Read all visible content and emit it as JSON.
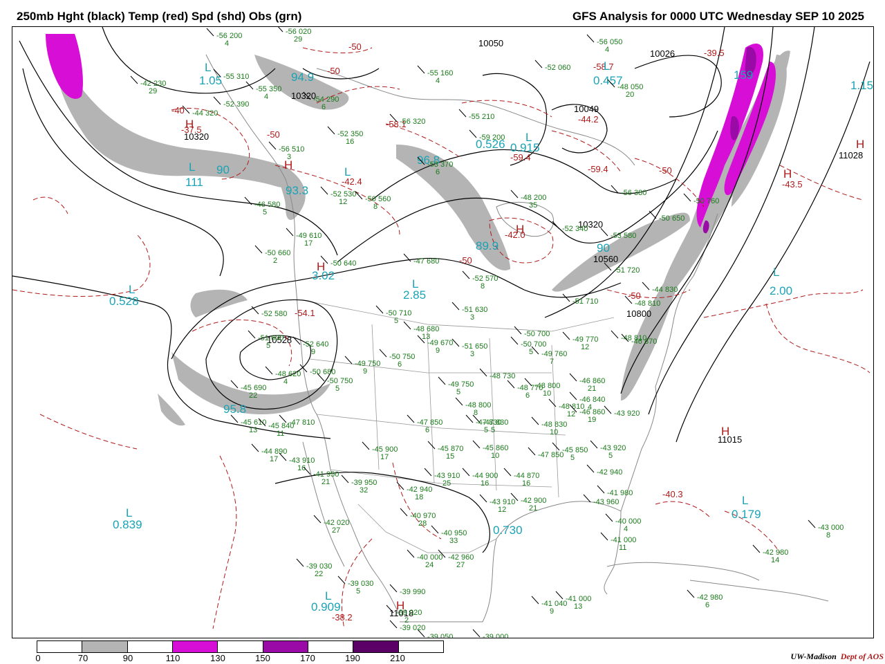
{
  "header": {
    "left_title": "250mb Hght (black) Temp (red) Spd (shd) Obs (grn)",
    "right_title": "GFS Analysis for 0000 UTC Wednesday  SEP 10 2025"
  },
  "colors": {
    "jet_70_90": "#b4b4b4",
    "jet_110_130": "#d60ed6",
    "jet_150_170": "#9a0aa6",
    "jet_190_210": "#5a0066",
    "height_contour": "#000000",
    "temp_contour": "#b01a1a",
    "speed_label": "#1aa3b5",
    "obs": "#1a7a1a"
  },
  "colorbar": {
    "ticks": [
      "0",
      "70",
      "90",
      "110",
      "130",
      "150",
      "170",
      "190",
      "210"
    ],
    "segments": [
      "#ffffff",
      "#b4b4b4",
      "#ffffff",
      "#d60ed6",
      "#ffffff",
      "#9a0aa6",
      "#ffffff",
      "#5a0066",
      "#ffffff"
    ]
  },
  "credit": {
    "institution": "UW-Madison",
    "dept": "Dept of AOS"
  },
  "speed_labels": [
    {
      "text": "1.05"
    },
    {
      "text": "94.9"
    },
    {
      "text": "111"
    },
    {
      "text": "90"
    },
    {
      "text": "93.3"
    },
    {
      "text": "0.528"
    },
    {
      "text": "3.02"
    },
    {
      "text": "2.85"
    },
    {
      "text": "96.8"
    },
    {
      "text": "89.9"
    },
    {
      "text": "0.526"
    },
    {
      "text": "0.915"
    },
    {
      "text": "0.457"
    },
    {
      "text": "90"
    },
    {
      "text": "2.00"
    },
    {
      "text": "95.8"
    },
    {
      "text": "0.839"
    },
    {
      "text": "0.730"
    },
    {
      "text": "0.179"
    },
    {
      "text": "0.909"
    },
    {
      "text": "159"
    },
    {
      "text": "1.15"
    }
  ],
  "height_labels": [
    {
      "text": "10320"
    },
    {
      "text": "10320"
    },
    {
      "text": "10050"
    },
    {
      "text": "10026"
    },
    {
      "text": "10049"
    },
    {
      "text": "11028"
    },
    {
      "text": "10320"
    },
    {
      "text": "10560"
    },
    {
      "text": "10800"
    },
    {
      "text": "10528"
    },
    {
      "text": "11015"
    },
    {
      "text": "11018"
    }
  ],
  "temp_labels": [
    {
      "text": "-50"
    },
    {
      "text": "-50"
    },
    {
      "text": "-40"
    },
    {
      "text": "-37.5"
    },
    {
      "text": "-50"
    },
    {
      "text": "-42.4"
    },
    {
      "text": "-58.1"
    },
    {
      "text": "-59.4"
    },
    {
      "text": "-59.4"
    },
    {
      "text": "-50"
    },
    {
      "text": "-43.5"
    },
    {
      "text": "-42.0"
    },
    {
      "text": "-50"
    },
    {
      "text": "-50"
    },
    {
      "text": "-54.1"
    },
    {
      "text": "-40.3"
    },
    {
      "text": "-38.2"
    },
    {
      "text": "-39.5"
    },
    {
      "text": "-58.7"
    },
    {
      "text": "-44.2"
    }
  ],
  "extrema": [
    {
      "text": "H"
    },
    {
      "text": "L"
    },
    {
      "text": "L"
    },
    {
      "text": "H"
    },
    {
      "text": "L"
    },
    {
      "text": "H"
    },
    {
      "text": "L"
    },
    {
      "text": "H"
    },
    {
      "text": "L"
    },
    {
      "text": "L"
    },
    {
      "text": "H"
    },
    {
      "text": "H"
    },
    {
      "text": "L"
    },
    {
      "text": "L"
    },
    {
      "text": "H"
    },
    {
      "text": "L"
    },
    {
      "text": "L"
    },
    {
      "text": "L"
    },
    {
      "text": "H"
    }
  ],
  "obs": [
    {
      "temp": "-56",
      "hgt": "200",
      "spd": "4"
    },
    {
      "temp": "-56",
      "hgt": "020",
      "spd": "29"
    },
    {
      "temp": "-42",
      "hgt": "230",
      "spd": "29"
    },
    {
      "temp": "-55",
      "hgt": "310",
      "spd": ""
    },
    {
      "temp": "-55",
      "hgt": "350",
      "spd": "4"
    },
    {
      "temp": "-54",
      "hgt": "290",
      "spd": "6"
    },
    {
      "temp": "-52",
      "hgt": "390",
      "spd": ""
    },
    {
      "temp": "-44",
      "hgt": "320",
      "spd": ""
    },
    {
      "temp": "-52",
      "hgt": "350",
      "spd": "16"
    },
    {
      "temp": "-56",
      "hgt": "320",
      "spd": ""
    },
    {
      "temp": "-53",
      "hgt": "370",
      "spd": "6"
    },
    {
      "temp": "-55",
      "hgt": "210",
      "spd": ""
    },
    {
      "temp": "-59",
      "hgt": "200",
      "spd": ""
    },
    {
      "temp": "-52",
      "hgt": "060",
      "spd": ""
    },
    {
      "temp": "-56",
      "hgt": "050",
      "spd": "4"
    },
    {
      "temp": "-48",
      "hgt": "050",
      "spd": "20"
    },
    {
      "temp": "-55",
      "hgt": "160",
      "spd": "4"
    },
    {
      "temp": "-56",
      "hgt": "510",
      "spd": "3"
    },
    {
      "temp": "-52",
      "hgt": "530",
      "spd": "12"
    },
    {
      "temp": "-50",
      "hgt": "560",
      "spd": "8"
    },
    {
      "temp": "-48",
      "hgt": "200",
      "spd": "35"
    },
    {
      "temp": "-52",
      "hgt": "340",
      "spd": ""
    },
    {
      "temp": "-56",
      "hgt": "380",
      "spd": ""
    },
    {
      "temp": "-50",
      "hgt": "650",
      "spd": ""
    },
    {
      "temp": "-53",
      "hgt": "580",
      "spd": ""
    },
    {
      "temp": "-50",
      "hgt": "760",
      "spd": ""
    },
    {
      "temp": "-46",
      "hgt": "580",
      "spd": "5"
    },
    {
      "temp": "-49",
      "hgt": "610",
      "spd": "17"
    },
    {
      "temp": "-50",
      "hgt": "640",
      "spd": ""
    },
    {
      "temp": "-47",
      "hgt": "680",
      "spd": ""
    },
    {
      "temp": "-50",
      "hgt": "660",
      "spd": "2"
    },
    {
      "temp": "-52",
      "hgt": "570",
      "spd": "8"
    },
    {
      "temp": "-51",
      "hgt": "720",
      "spd": ""
    },
    {
      "temp": "-44",
      "hgt": "830",
      "spd": ""
    },
    {
      "temp": "-51",
      "hgt": "710",
      "spd": ""
    },
    {
      "temp": "-48",
      "hgt": "810",
      "spd": ""
    },
    {
      "temp": "-48",
      "hgt": "810",
      "spd": ""
    },
    {
      "temp": "-52",
      "hgt": "580",
      "spd": ""
    },
    {
      "temp": "-51",
      "hgt": "600",
      "spd": "5"
    },
    {
      "temp": "-52",
      "hgt": "640",
      "spd": "9"
    },
    {
      "temp": "-50",
      "hgt": "710",
      "spd": "5"
    },
    {
      "temp": "-51",
      "hgt": "630",
      "spd": "3"
    },
    {
      "temp": "-48",
      "hgt": "680",
      "spd": "13"
    },
    {
      "temp": "-49",
      "hgt": "670",
      "spd": "9"
    },
    {
      "temp": "-51",
      "hgt": "650",
      "spd": "3"
    },
    {
      "temp": "-50",
      "hgt": "700",
      "spd": "5"
    },
    {
      "temp": "-50",
      "hgt": "700",
      "spd": ""
    },
    {
      "temp": "-49",
      "hgt": "770",
      "spd": "12"
    },
    {
      "temp": "-49",
      "hgt": "760",
      "spd": "7"
    },
    {
      "temp": "-46",
      "hgt": "870",
      "spd": ""
    },
    {
      "temp": "-48",
      "hgt": "620",
      "spd": "4"
    },
    {
      "temp": "-50",
      "hgt": "680",
      "spd": ""
    },
    {
      "temp": "-50",
      "hgt": "750",
      "spd": "5"
    },
    {
      "temp": "-49",
      "hgt": "750",
      "spd": "9"
    },
    {
      "temp": "-50",
      "hgt": "750",
      "spd": "6"
    },
    {
      "temp": "-45",
      "hgt": "690",
      "spd": "22"
    },
    {
      "temp": "-48",
      "hgt": "730",
      "spd": ""
    },
    {
      "temp": "-48",
      "hgt": "770",
      "spd": "6"
    },
    {
      "temp": "-48",
      "hgt": "800",
      "spd": "10"
    },
    {
      "temp": "-48",
      "hgt": "810",
      "spd": "12"
    },
    {
      "temp": "-46",
      "hgt": "860",
      "spd": "21"
    },
    {
      "temp": "-49",
      "hgt": "750",
      "spd": "5"
    },
    {
      "temp": "-48",
      "hgt": "800",
      "spd": "8"
    },
    {
      "temp": "-47",
      "hgt": "830",
      "spd": "5"
    },
    {
      "temp": "-47",
      "hgt": "830",
      "spd": "5"
    },
    {
      "temp": "-48",
      "hgt": "830",
      "spd": "10"
    },
    {
      "temp": "-46",
      "hgt": "840",
      "spd": "4"
    },
    {
      "temp": "-46",
      "hgt": "860",
      "spd": "19"
    },
    {
      "temp": "-43",
      "hgt": "920",
      "spd": ""
    },
    {
      "temp": "-45",
      "hgt": "610",
      "spd": "13"
    },
    {
      "temp": "-45",
      "hgt": "840",
      "spd": "11"
    },
    {
      "temp": "-47",
      "hgt": "810",
      "spd": ""
    },
    {
      "temp": "-47",
      "hgt": "850",
      "spd": "6"
    },
    {
      "temp": "-44",
      "hgt": "890",
      "spd": "17"
    },
    {
      "temp": "-43",
      "hgt": "910",
      "spd": "16"
    },
    {
      "temp": "-45",
      "hgt": "900",
      "spd": "17"
    },
    {
      "temp": "-45",
      "hgt": "870",
      "spd": "15"
    },
    {
      "temp": "-45",
      "hgt": "860",
      "spd": "10"
    },
    {
      "temp": "-47",
      "hgt": "850",
      "spd": ""
    },
    {
      "temp": "-45",
      "hgt": "850",
      "spd": "5"
    },
    {
      "temp": "-43",
      "hgt": "920",
      "spd": "5"
    },
    {
      "temp": "-41",
      "hgt": "950",
      "spd": "21"
    },
    {
      "temp": "-39",
      "hgt": "950",
      "spd": "32"
    },
    {
      "temp": "-43",
      "hgt": "910",
      "spd": "25"
    },
    {
      "temp": "-44",
      "hgt": "900",
      "spd": "16"
    },
    {
      "temp": "-44",
      "hgt": "870",
      "spd": "16"
    },
    {
      "temp": "-42",
      "hgt": "940",
      "spd": "18"
    },
    {
      "temp": "-43",
      "hgt": "910",
      "spd": "12"
    },
    {
      "temp": "-42",
      "hgt": "900",
      "spd": "21"
    },
    {
      "temp": "-42",
      "hgt": "940",
      "spd": ""
    },
    {
      "temp": "-41",
      "hgt": "980",
      "spd": ""
    },
    {
      "temp": "-43",
      "hgt": "960",
      "spd": ""
    },
    {
      "temp": "-40",
      "hgt": "000",
      "spd": "4"
    },
    {
      "temp": "-41",
      "hgt": "000",
      "spd": "11"
    },
    {
      "temp": "-42",
      "hgt": "020",
      "spd": "27"
    },
    {
      "temp": "-40",
      "hgt": "970",
      "spd": "28"
    },
    {
      "temp": "-40",
      "hgt": "950",
      "spd": "33"
    },
    {
      "temp": "-40",
      "hgt": "000",
      "spd": "24"
    },
    {
      "temp": "-42",
      "hgt": "960",
      "spd": "27"
    },
    {
      "temp": "-39",
      "hgt": "030",
      "spd": "22"
    },
    {
      "temp": "-39",
      "hgt": "030",
      "spd": "5"
    },
    {
      "temp": "-39",
      "hgt": "990",
      "spd": ""
    },
    {
      "temp": "-39",
      "hgt": "020",
      "spd": "2"
    },
    {
      "temp": "-39",
      "hgt": "050",
      "spd": ""
    },
    {
      "temp": "-39",
      "hgt": "000",
      "spd": ""
    },
    {
      "temp": "-39",
      "hgt": "020",
      "spd": ""
    },
    {
      "temp": "-41",
      "hgt": "000",
      "spd": "13"
    },
    {
      "temp": "-41",
      "hgt": "040",
      "spd": "9"
    },
    {
      "temp": "-42",
      "hgt": "980",
      "spd": "6"
    },
    {
      "temp": "-42",
      "hgt": "980",
      "spd": "14"
    },
    {
      "temp": "-43",
      "hgt": "000",
      "spd": "8"
    }
  ]
}
